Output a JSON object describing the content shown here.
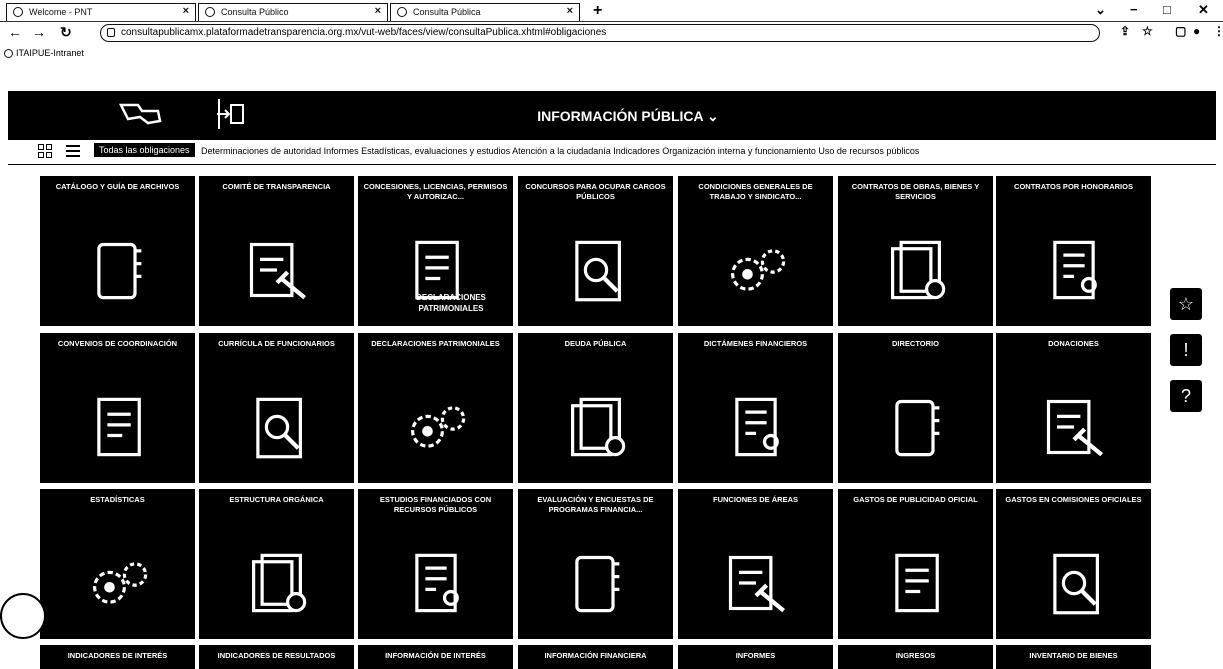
{
  "browser": {
    "tabs": [
      "Welcome - PNT",
      "Consulta Público",
      "Consulta Pública"
    ],
    "url": "consultapublicamx.plataformadetransparencia.org.mx/vut-web/faces/view/consultaPublica.xhtml#obligaciones",
    "bookmark": "ITAIPUE-Intranet"
  },
  "header": {
    "title": "INFORMACIÓN PÚBLICA ⌄"
  },
  "catbar": {
    "all": "Todas las obligaciones",
    "categories": "Determinaciones de autoridad  Informes  Estadísticas, evaluaciones y estudios  Atención a la ciudadanía  Indicadores  Organización interna y funcionamiento  Uso de recursos públicos"
  },
  "tiles": [
    [
      "CATÁLOGO Y GUÍA DE ARCHIVOS",
      "COMITÉ DE TRANSPARENCIA",
      "CONCESIONES, LICENCIAS, PERMISOS Y AUTORIZAC...",
      "CONCURSOS PARA OCUPAR CARGOS PÚBLICOS",
      "CONDICIONES GENERALES DE TRABAJO Y SINDICATO...",
      "CONTRATOS DE OBRAS, BIENES Y SERVICIOS",
      "CONTRATOS POR HONORARIOS"
    ],
    [
      "CONVENIOS DE COORDINACIÓN",
      "CURRÍCULA DE FUNCIONARIOS",
      "DECLARACIONES PATRIMONIALES",
      "DEUDA PÚBLICA",
      "DICTÁMENES FINANCIEROS",
      "DIRECTORIO",
      "DONACIONES"
    ],
    [
      "ESTADÍSTICAS",
      "ESTRUCTURA ORGÁNICA",
      "ESTUDIOS FINANCIADOS CON RECURSOS PÚBLICOS",
      "EVALUACIÓN Y ENCUESTAS DE PROGRAMAS FINANCIA...",
      "FUNCIONES DE ÁREAS",
      "GASTOS DE PUBLICIDAD OFICIAL",
      "GASTOS EN COMISIONES OFICIALES"
    ],
    [
      "INDICADORES DE INTERÉS",
      "INDICADORES DE RESULTADOS",
      "INFORMACIÓN DE INTERÉS",
      "INFORMACIÓN FINANCIERA",
      "INFORMES",
      "INGRESOS",
      "INVENTARIO DE BIENES"
    ]
  ],
  "tooltip": "DECLARACIONES PATRIMONIALES"
}
